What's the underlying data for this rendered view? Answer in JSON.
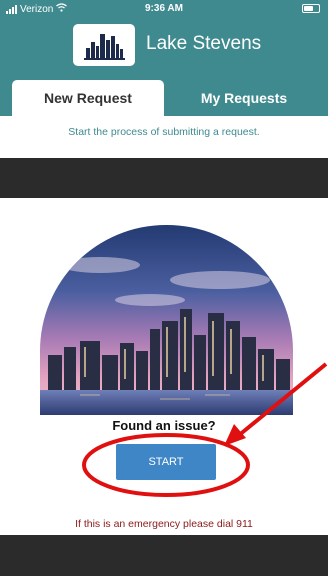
{
  "status_bar": {
    "carrier": "Verizon",
    "time": "9:36 AM",
    "signal_icon": "cell-signal-icon",
    "wifi_icon": "wifi-icon",
    "battery_icon": "battery-icon"
  },
  "header": {
    "title": "Lake Stevens",
    "logo_icon": "city-skyline-logo"
  },
  "tabs": [
    {
      "label": "New Request",
      "active": true
    },
    {
      "label": "My Requests",
      "active": false
    }
  ],
  "main": {
    "subtitle": "Start the process of submitting a request.",
    "prompt": "Found an issue?",
    "start_label": "START",
    "emergency_text": "If this is an emergency please dial 911"
  },
  "colors": {
    "brand_teal": "#3f8a8f",
    "start_button": "#3f86c6",
    "emergency_text": "#8b1a1a",
    "dark_band": "#2b2b2b",
    "annotation_red": "#e01010"
  }
}
